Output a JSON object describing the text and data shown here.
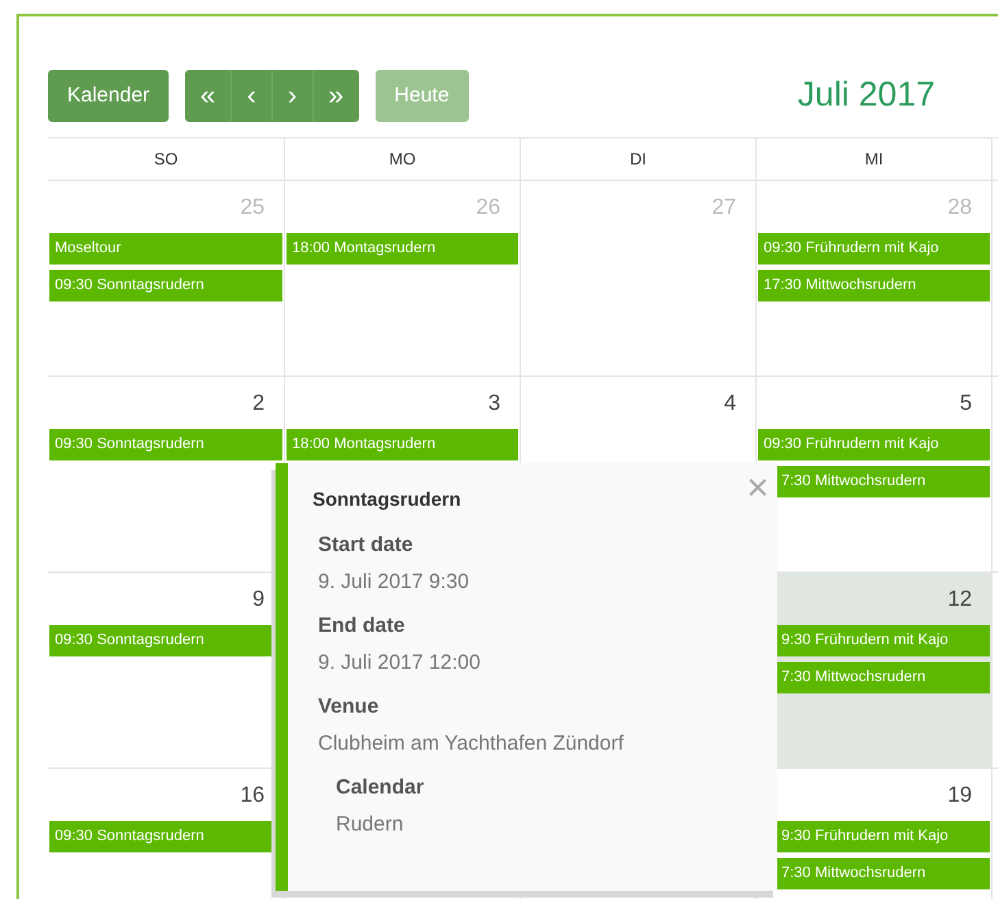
{
  "toolbar": {
    "view_button": "Kalender",
    "nav_buttons": [
      "«",
      "‹",
      "›",
      "»"
    ],
    "today_button": {
      "label": "Heute",
      "disabled": true
    },
    "title": "Juli 2017"
  },
  "calendar": {
    "weekdays": [
      "SO",
      "MO",
      "DI",
      "MI"
    ],
    "weeks": [
      {
        "days": [
          {
            "number": "25",
            "other_month": true,
            "today": false,
            "events": [
              {
                "text": "Moseltour",
                "partly_hidden": false
              },
              {
                "text": "09:30 Sonntagsrudern",
                "partly_hidden": false
              }
            ]
          },
          {
            "number": "26",
            "other_month": true,
            "today": false,
            "events": [
              {
                "text": "18:00 Montagsrudern",
                "partly_hidden": false
              }
            ]
          },
          {
            "number": "27",
            "other_month": true,
            "today": false
          },
          {
            "number": "28",
            "other_month": true,
            "today": false,
            "events": [
              {
                "text": "09:30 Frührudern mit Kajo",
                "partly_hidden": false
              },
              {
                "text": "17:30 Mittwochsrudern",
                "partly_hidden": false
              }
            ]
          }
        ]
      },
      {
        "days": [
          {
            "number": "2",
            "other_month": false,
            "today": false,
            "events": [
              {
                "text": "09:30 Sonntagsrudern",
                "partly_hidden": false
              }
            ]
          },
          {
            "number": "3",
            "other_month": false,
            "today": false,
            "events": [
              {
                "text": "18:00 Montagsrudern",
                "partly_hidden": false
              }
            ]
          },
          {
            "number": "4",
            "other_month": false,
            "today": false
          },
          {
            "number": "5",
            "other_month": false,
            "today": false,
            "events": [
              {
                "text": "09:30 Frührudern mit Kajo",
                "partly_hidden": false
              },
              {
                "text": "7:30 Mittwochsrudern",
                "partly_hidden": true
              }
            ]
          }
        ]
      },
      {
        "days": [
          {
            "number": "9",
            "other_month": false,
            "today": false,
            "events": [
              {
                "text": "09:30 Sonntagsrudern",
                "partly_hidden": false
              }
            ]
          },
          {
            "number": "12",
            "other_month": false,
            "today": true,
            "events": [
              {
                "text": "9:30 Frührudern mit Kajo",
                "partly_hidden": true
              },
              {
                "text": "7:30 Mittwochsrudern",
                "partly_hidden": true
              }
            ]
          }
        ]
      },
      {
        "days": [
          {
            "number": "16",
            "other_month": false,
            "today": false,
            "events": [
              {
                "text": "09:30 Sonntagsrudern",
                "partly_hidden": false
              }
            ]
          },
          {
            "number": "19",
            "other_month": false,
            "today": false,
            "events": [
              {
                "text": "9:30 Frührudern mit Kajo",
                "partly_hidden": true
              },
              {
                "text": "7:30 Mittwochsrudern",
                "partly_hidden": true
              }
            ]
          }
        ]
      }
    ]
  },
  "popup": {
    "title": "Sonntagsrudern",
    "close": "×",
    "fields": [
      {
        "label": "Start date",
        "value": "9. Juli 2017 9:30",
        "indented": false
      },
      {
        "label": "End date",
        "value": "9. Juli 2017 12:00",
        "indented": false
      },
      {
        "label": "Venue",
        "value": "Clubheim am Yachthafen Zündorf",
        "indented": false
      },
      {
        "label": "Calendar",
        "value": "Rudern",
        "indented": true
      }
    ]
  }
}
